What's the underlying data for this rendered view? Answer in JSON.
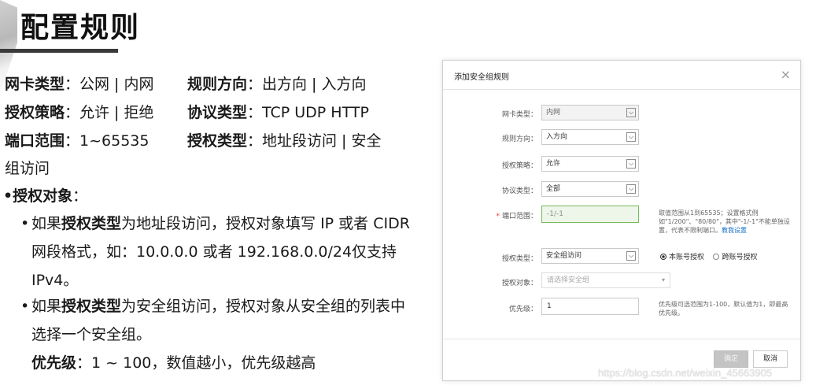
{
  "slide": {
    "title": "配置规则",
    "lines": [
      {
        "k1": "网卡类型",
        "v1": "：公网 | 内网",
        "k2": "规则方向",
        "v2": "：出方向 | 入方向"
      },
      {
        "k1": "授权策略",
        "v1": "：允许 | 拒绝",
        "k2": "协议类型",
        "v2": "：TCP UDP  HTTP"
      },
      {
        "k1": "端口范围",
        "v1": "：1~65535",
        "k2": "授权类型",
        "v2": "：地址段访问 | 安全"
      }
    ],
    "line3_wrap": "组访问",
    "target_heading": "•授权对象",
    "target_colon": "：",
    "sub1_pre": "如果",
    "sub1_key": "授权类型",
    "sub1_post": "为地址段访问，授权对象填写 IP 或者 CIDR 网段格式，如：10.0.0.0 或者 192.168.0.0/24仅支持 IPv4。",
    "sub2_pre": "如果",
    "sub2_key": "授权类型",
    "sub2_post": "为安全组访问，授权对象从安全组的列表中选择一个安全组。",
    "priority_key": "优先级",
    "priority_val": "：1 ~ 100，数值越小，优先级越高"
  },
  "dialog": {
    "title": "添加安全组规则",
    "close": "×",
    "fields": {
      "nic_type": {
        "label": "网卡类型：",
        "value": "内网"
      },
      "direction": {
        "label": "规则方向：",
        "value": "入方向"
      },
      "policy": {
        "label": "授权策略：",
        "value": "允许"
      },
      "protocol": {
        "label": "协议类型：",
        "value": "全部"
      },
      "port": {
        "label": "端口范围：",
        "required": "*",
        "value": "-1/-1",
        "help": "取值范围从1到65535；设置格式例如\"1/200\"、\"80/80\"，其中\"-1/-1\"不能单独设置，代表不限制端口。",
        "help_link": "教我设置"
      },
      "auth_type": {
        "label": "授权类型：",
        "value": "安全组访问",
        "radio_this": "本账号授权",
        "radio_cross": "跨账号授权"
      },
      "auth_target": {
        "label": "授权对象：",
        "placeholder": "请选择安全组"
      },
      "priority": {
        "label": "优先级：",
        "value": "1",
        "help": "优先级可选范围为1-100，默认值为1，即最高优先级。"
      }
    },
    "ok": "确定",
    "cancel": "取消"
  },
  "watermark": "https://blog.csdn.net/weixin_45663905"
}
